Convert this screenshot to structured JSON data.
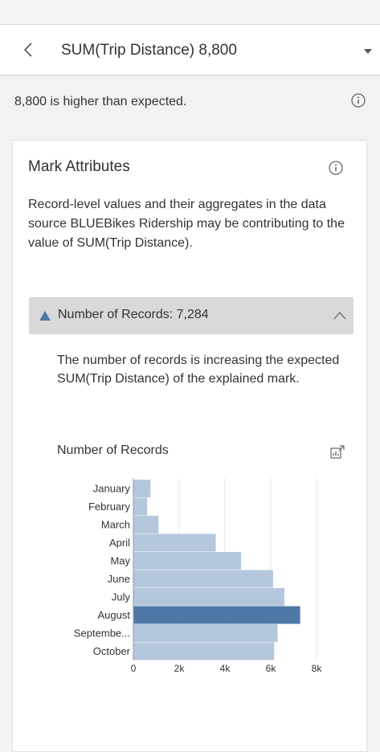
{
  "header": {
    "title": "SUM(Trip Distance)  8,800"
  },
  "summary": {
    "text": "8,800 is higher than expected."
  },
  "card": {
    "title": "Mark Attributes",
    "description": "Record-level values and their aggregates in the data source BLUEBikes Ridership may be contributing to the value of SUM(Trip Distance).",
    "section": {
      "label": "Number of Records: 7,284",
      "description": "The number of records is increasing the expected SUM(Trip Distance) of the explained mark."
    }
  },
  "colors": {
    "bar": "#b5c7dc",
    "bar_highlight": "#4e79a7",
    "indicator": "#4e79a7"
  },
  "icons": {
    "back": "chevron-left-icon",
    "dropdown": "caret-down-icon",
    "info": "info-icon",
    "indicator": "triangle-up-icon",
    "collapse": "chevron-up-icon",
    "open_chart": "open-chart-icon"
  },
  "chart_data": {
    "type": "bar",
    "orientation": "horizontal",
    "title": "Number of Records",
    "categories": [
      "January",
      "February",
      "March",
      "April",
      "May",
      "June",
      "July",
      "August",
      "Septembe...",
      "October"
    ],
    "values": [
      750,
      600,
      1100,
      3600,
      4700,
      6100,
      6600,
      7284,
      6300,
      6150
    ],
    "highlight": "August",
    "xlim": [
      0,
      8000
    ],
    "xticks": [
      "0",
      "2k",
      "4k",
      "6k",
      "8k"
    ],
    "xtick_values": [
      0,
      2000,
      4000,
      6000,
      8000
    ],
    "grid": true
  }
}
